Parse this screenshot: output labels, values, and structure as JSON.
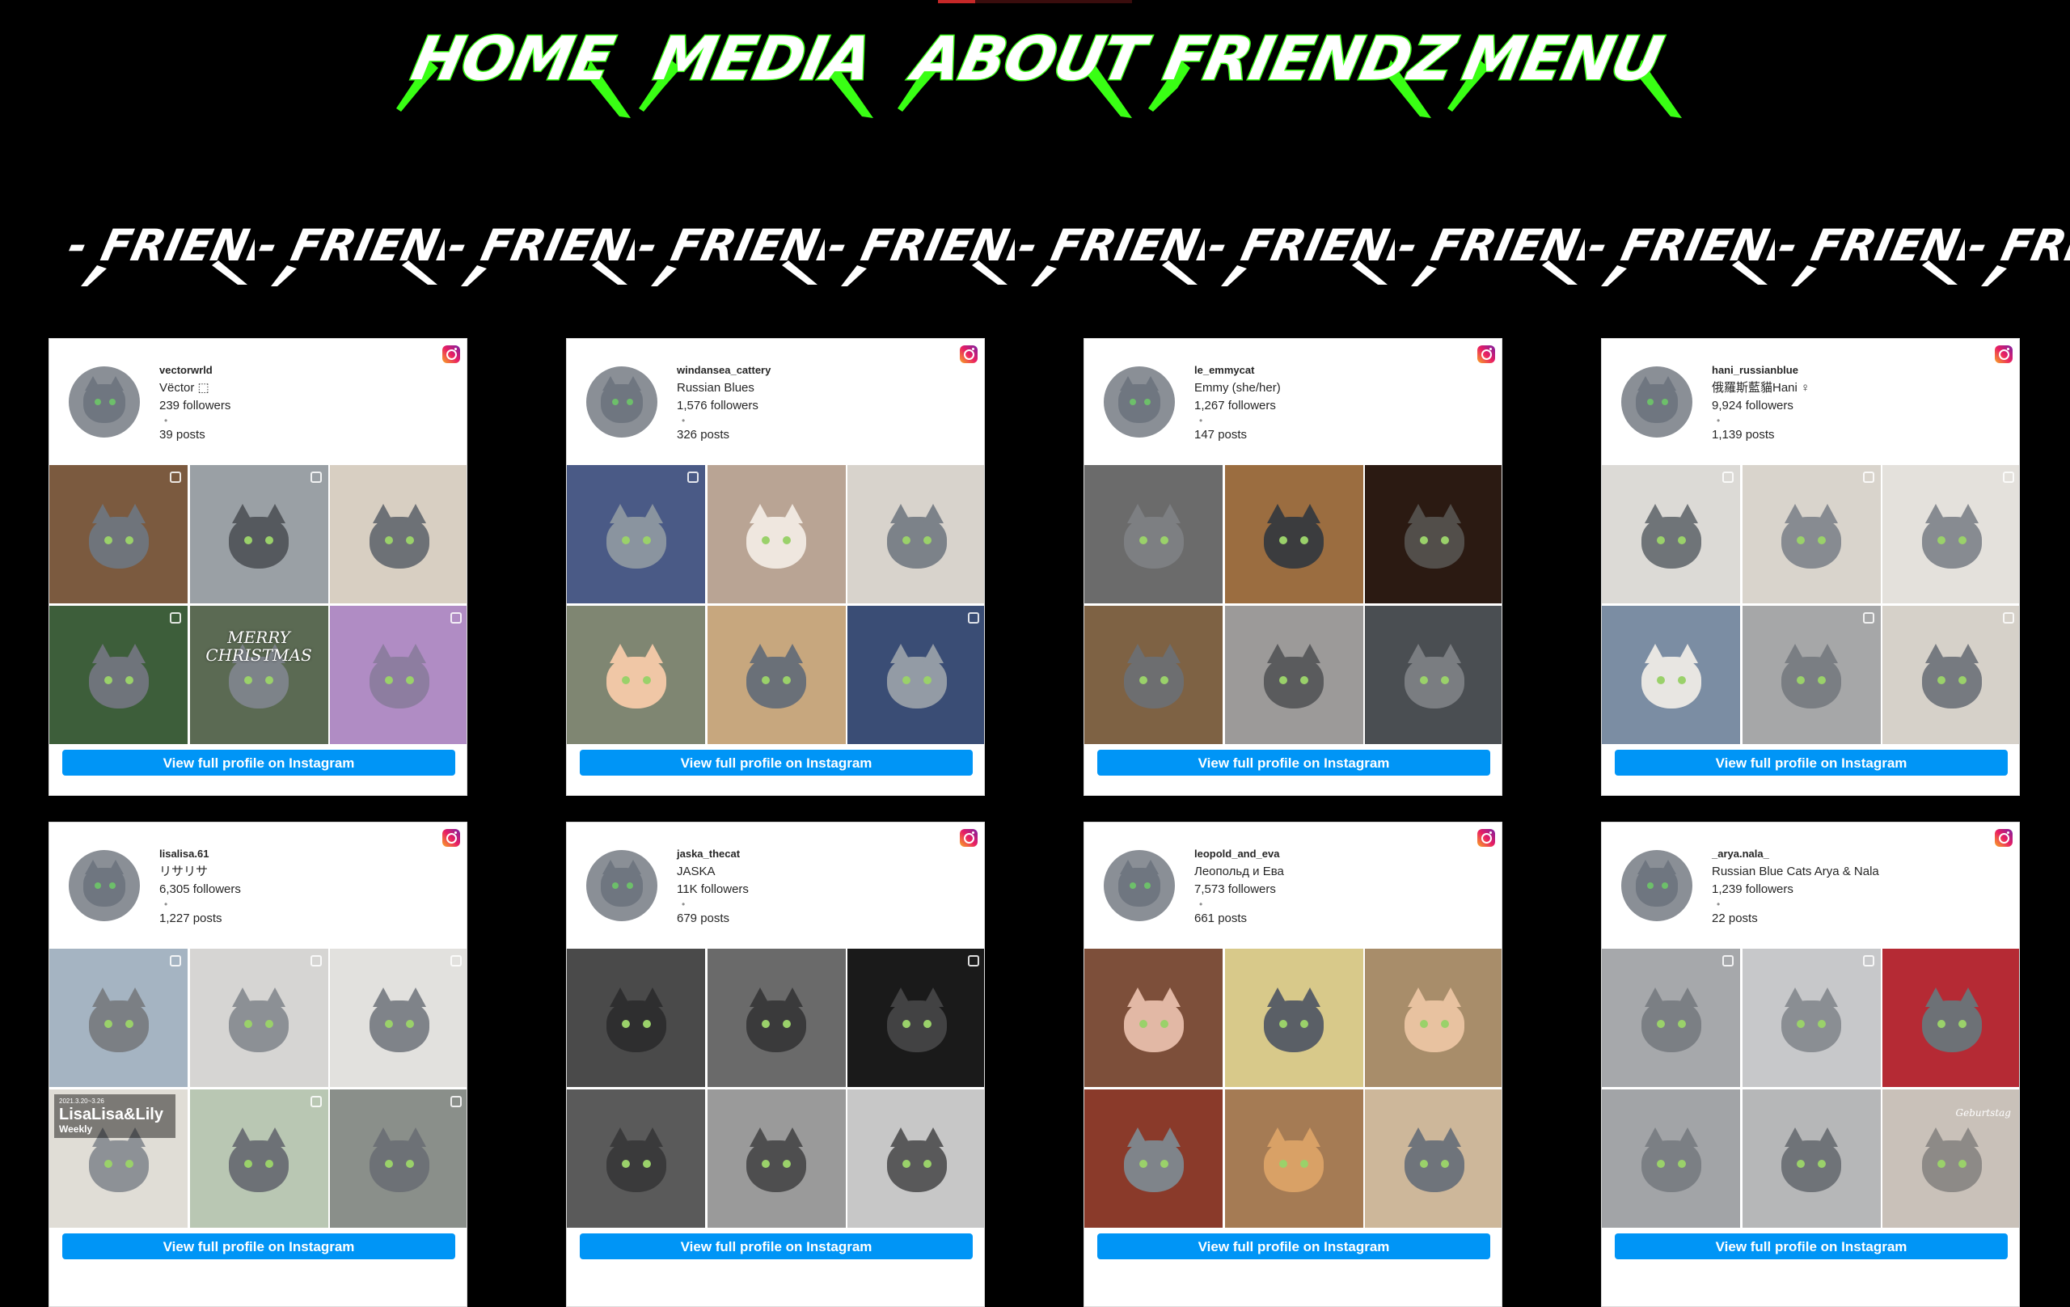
{
  "nav": {
    "items": [
      {
        "label": "HOME"
      },
      {
        "label": "MEDIA"
      },
      {
        "label": "ABOUT"
      },
      {
        "label": "FRIENDZ"
      },
      {
        "label": "MENU"
      }
    ]
  },
  "marquee": {
    "text": "- FRIENDZ",
    "repeat": 11
  },
  "cards": [
    {
      "username": "vectorwrld",
      "full_name": "Vëctor ⬚",
      "followers": "239 followers",
      "dot": "•",
      "posts": "39 posts",
      "button": "View full profile on Instagram",
      "photos": [
        {
          "bg": "#7b5a3f",
          "cat": "#6f747b",
          "badge": true
        },
        {
          "bg": "#9aa0a5",
          "cat": "#55595e",
          "badge": true
        },
        {
          "bg": "#d8cfc2",
          "cat": "#6d7176",
          "badge": false
        },
        {
          "bg": "#3d5e3a",
          "cat": "#6f747b",
          "badge": true
        },
        {
          "bg": "#5b6a53",
          "cat": "#7d8389",
          "overlay": "MERRY CHRISTMAS"
        },
        {
          "bg": "#b08cc4",
          "cat": "#8d7da0",
          "badge": true
        }
      ]
    },
    {
      "username": "windansea_cattery",
      "full_name": "Russian Blues",
      "followers": "1,576 followers",
      "dot": "•",
      "posts": "326 posts",
      "button": "View full profile on Instagram",
      "photos": [
        {
          "bg": "#4a5a86",
          "cat": "#8a949f",
          "badge": true
        },
        {
          "bg": "#b9a494",
          "cat": "#efe7df",
          "badge": false
        },
        {
          "bg": "#d8d3cc",
          "cat": "#7c8289",
          "badge": false
        },
        {
          "bg": "#7f8672",
          "cat": "#f0c7a6",
          "badge": false
        },
        {
          "bg": "#c7a77e",
          "cat": "#6a7078",
          "badge": false
        },
        {
          "bg": "#3a4d75",
          "cat": "#939ba5",
          "badge": true
        }
      ]
    },
    {
      "username": "le_emmycat",
      "full_name": "Emmy (she/her)",
      "followers": "1,267 followers",
      "dot": "•",
      "posts": "147 posts",
      "button": "View full profile on Instagram",
      "photos": [
        {
          "bg": "#6b6b6b",
          "cat": "#7d7f82",
          "badge": false
        },
        {
          "bg": "#9b6d40",
          "cat": "#3b3c3e",
          "badge": false
        },
        {
          "bg": "#2b1a12",
          "cat": "#524e4a",
          "badge": false
        },
        {
          "bg": "#7e6244",
          "cat": "#6d6e70",
          "badge": false
        },
        {
          "bg": "#9c9a99",
          "cat": "#5a5b5d",
          "badge": false
        },
        {
          "bg": "#4a4e52",
          "cat": "#7a7d81",
          "badge": false
        }
      ]
    },
    {
      "username": "hani_russianblue",
      "full_name": "俄羅斯藍貓Hani ♀",
      "followers": "9,924 followers",
      "dot": "•",
      "posts": "1,139 posts",
      "button": "View full profile on Instagram",
      "photos": [
        {
          "bg": "#dcdad6",
          "cat": "#6f7478",
          "badge": true
        },
        {
          "bg": "#d9d4cc",
          "cat": "#878b91",
          "badge": true
        },
        {
          "bg": "#e4e1dc",
          "cat": "#878b91",
          "badge": true
        },
        {
          "bg": "#7b8da3",
          "cat": "#e8e6e2",
          "badge": false
        },
        {
          "bg": "#a6a7a8",
          "cat": "#7a7e83",
          "badge": true
        },
        {
          "bg": "#d6d1c9",
          "cat": "#767a80",
          "badge": true
        }
      ]
    },
    {
      "username": "lisalisa.61",
      "full_name": "リサリサ",
      "followers": "6,305 followers",
      "dot": "•",
      "posts": "1,227 posts",
      "button": "View full profile on Instagram",
      "photos": [
        {
          "bg": "#a5b4c2",
          "cat": "#7b7f84",
          "badge": true
        },
        {
          "bg": "#d6d5d3",
          "cat": "#8c9095",
          "badge": true
        },
        {
          "bg": "#e2e1de",
          "cat": "#7f8389",
          "badge": true
        },
        {
          "bg": "#e0ddd6",
          "cat": "#8d9196",
          "weekly": {
            "date": "2021.3.20~3.26",
            "title": "LisaLisa&Lily",
            "sub": "Weekly"
          }
        },
        {
          "bg": "#b9c7b3",
          "cat": "#6d7176",
          "badge": true
        },
        {
          "bg": "#8a8f8a",
          "cat": "#6d7176",
          "badge": true
        }
      ]
    },
    {
      "username": "jaska_thecat",
      "full_name": "JASKA",
      "followers": "11K followers",
      "dot": "•",
      "posts": "679 posts",
      "button": "View full profile on Instagram",
      "photos": [
        {
          "bg": "#4a4a4a",
          "cat": "#2e2e2f",
          "badge": false
        },
        {
          "bg": "#6a6a6a",
          "cat": "#3a3a3b",
          "badge": false
        },
        {
          "bg": "#1a1a1a",
          "cat": "#424243",
          "badge": true
        },
        {
          "bg": "#5a5a5a",
          "cat": "#3a3a3b",
          "badge": false
        },
        {
          "bg": "#9a9a9a",
          "cat": "#4e4e4f",
          "badge": false
        },
        {
          "bg": "#c7c7c7",
          "cat": "#59595a",
          "badge": false
        }
      ]
    },
    {
      "username": "leopold_and_eva",
      "full_name": "Леопольд и Ева",
      "followers": "7,573 followers",
      "dot": "•",
      "posts": "661 posts",
      "button": "View full profile on Instagram",
      "photos": [
        {
          "bg": "#7d4f3a",
          "cat": "#e2b8a5",
          "badge": false
        },
        {
          "bg": "#d8c98a",
          "cat": "#5a5f66",
          "badge": false
        },
        {
          "bg": "#a88d6a",
          "cat": "#e8c2a0",
          "badge": false
        },
        {
          "bg": "#8a3a2a",
          "cat": "#7f848a",
          "badge": false
        },
        {
          "bg": "#a57b54",
          "cat": "#d9a166",
          "badge": false
        },
        {
          "bg": "#cdb79a",
          "cat": "#6f747b",
          "badge": false
        }
      ]
    },
    {
      "username": "_arya.nala_",
      "full_name": "Russian Blue Cats Arya & Nala",
      "followers": "1,239 followers",
      "dot": "•",
      "posts": "22 posts",
      "button": "View full profile on Instagram",
      "photos": [
        {
          "bg": "#a6a8ab",
          "cat": "#7b7f84",
          "badge": true
        },
        {
          "bg": "#c7c8ca",
          "cat": "#8a8e93",
          "badge": true
        },
        {
          "bg": "#b52a34",
          "cat": "#6d7176",
          "badge": false
        },
        {
          "bg": "#a2a4a7",
          "cat": "#7b7f84",
          "badge": false
        },
        {
          "bg": "#b6b7b8",
          "cat": "#6f7378",
          "badge": false
        },
        {
          "bg": "#c9c1b9",
          "cat": "#8d8a87",
          "corner": "Geburtstag"
        }
      ]
    }
  ]
}
